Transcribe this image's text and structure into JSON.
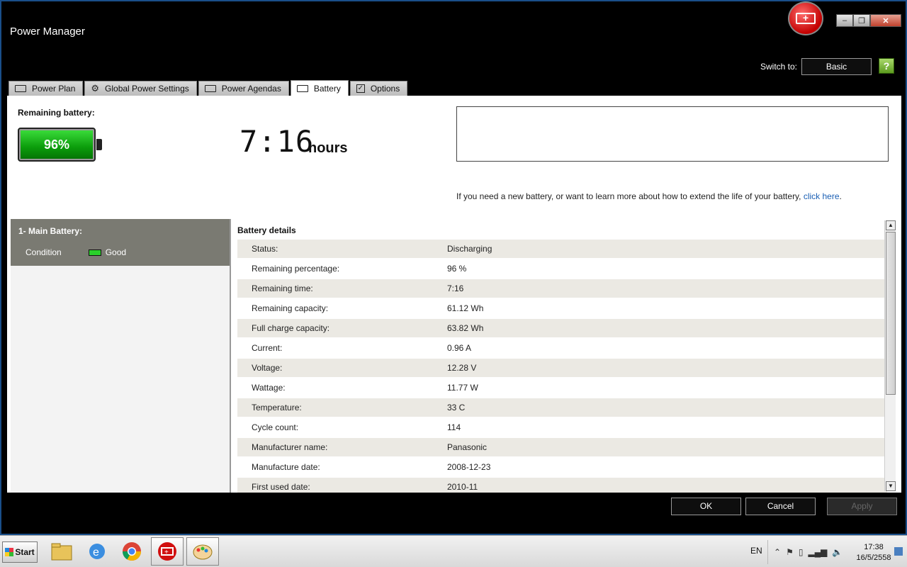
{
  "window": {
    "title": "Power Manager",
    "controls": {
      "minimize": "–",
      "restore": "❐",
      "close": "✕"
    }
  },
  "header": {
    "switch_label": "Switch to:",
    "switch_button": "Basic",
    "help_icon": "?"
  },
  "tabs": [
    {
      "label": "Power Plan",
      "icon": "battery-outline-icon"
    },
    {
      "label": "Global Power Settings",
      "icon": "gear-icon"
    },
    {
      "label": "Power Agendas",
      "icon": "battery-clock-icon"
    },
    {
      "label": "Battery",
      "icon": "battery-outline-icon",
      "active": true
    },
    {
      "label": "Options",
      "icon": "checkbox-icon"
    }
  ],
  "summary": {
    "remaining_label": "Remaining battery:",
    "percent": "96%",
    "percent_value": 96,
    "time": "7:16",
    "time_unit": "hours",
    "info_text": "If you need a new battery, or want to learn more about how to extend the life of your battery, ",
    "info_link": "click here",
    "info_tail": "."
  },
  "battery_list": {
    "title": "1- Main Battery:",
    "condition_label": "Condition",
    "condition_value": "Good"
  },
  "details": {
    "title": "Battery details",
    "rows": [
      {
        "label": "Status:",
        "value": "Discharging"
      },
      {
        "label": "Remaining percentage:",
        "value": "96 %"
      },
      {
        "label": "Remaining time:",
        "value": "7:16"
      },
      {
        "label": "Remaining capacity:",
        "value": "61.12 Wh"
      },
      {
        "label": "Full charge capacity:",
        "value": "63.82 Wh"
      },
      {
        "label": "Current:",
        "value": "0.96 A"
      },
      {
        "label": "Voltage:",
        "value": "12.28 V"
      },
      {
        "label": "Wattage:",
        "value": "11.77 W"
      },
      {
        "label": "Temperature:",
        "value": "33 C"
      },
      {
        "label": "Cycle count:",
        "value": "114"
      },
      {
        "label": "Manufacturer name:",
        "value": "Panasonic"
      },
      {
        "label": "Manufacture date:",
        "value": "2008-12-23"
      },
      {
        "label": "First used date:",
        "value": "2010-11"
      }
    ]
  },
  "footer": {
    "ok": "OK",
    "cancel": "Cancel",
    "apply": "Apply"
  },
  "taskbar": {
    "start": "Start",
    "apps": [
      "file-explorer-icon",
      "internet-explorer-icon",
      "chrome-icon",
      "power-manager-icon",
      "paint-icon"
    ],
    "language": "EN",
    "time": "17:38",
    "date": "16/5/2558"
  },
  "colors": {
    "battery_green": "#1fc21f",
    "link_blue": "#1a5fb4",
    "row_alt": "#ebe9e3",
    "left_header": "#7a7a72"
  }
}
